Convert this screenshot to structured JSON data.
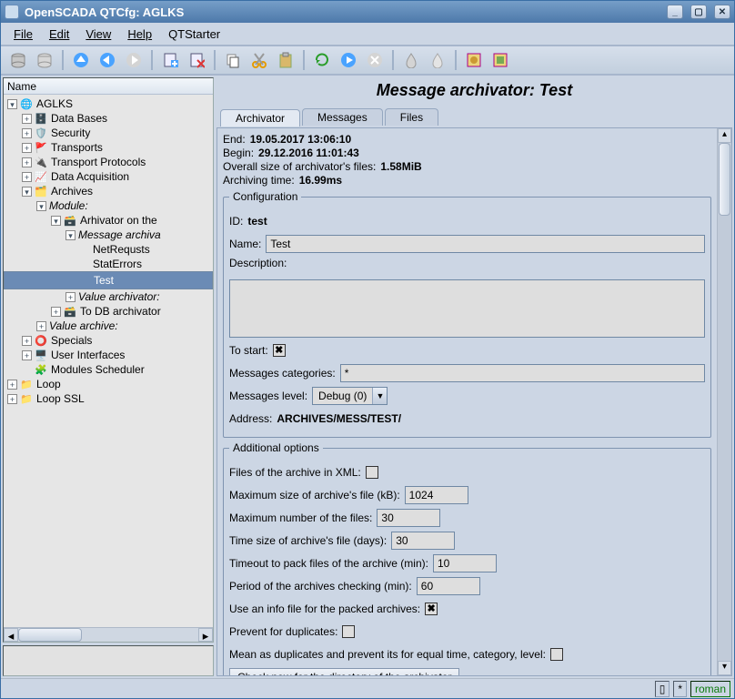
{
  "window": {
    "title": "OpenSCADA QTCfg: AGLKS",
    "buttons": {
      "min": "_",
      "max": "▢",
      "close": "✕"
    }
  },
  "menu": [
    "File",
    "Edit",
    "View",
    "Help",
    "QTStarter"
  ],
  "toolbar_icons": [
    "db-grey-icon",
    "db-grey2-icon",
    "sep",
    "arrow-up-icon",
    "arrow-back-icon",
    "arrow-fwd-icon",
    "sep",
    "add-item-icon",
    "delete-item-icon",
    "sep",
    "copy-icon",
    "cut-icon",
    "paste-icon",
    "sep",
    "refresh-icon",
    "play-icon",
    "stop-icon",
    "sep",
    "drop-icon",
    "drop2-icon",
    "sep",
    "module1-icon",
    "module2-icon"
  ],
  "tree": {
    "header": "Name",
    "nodes": [
      {
        "d": 0,
        "exp": "-",
        "icon": "🌐",
        "label": "AGLKS"
      },
      {
        "d": 1,
        "exp": "+",
        "icon": "🗄️",
        "label": "Data Bases"
      },
      {
        "d": 1,
        "exp": "+",
        "icon": "🛡️",
        "label": "Security"
      },
      {
        "d": 1,
        "exp": "+",
        "icon": "🚩",
        "label": "Transports"
      },
      {
        "d": 1,
        "exp": "+",
        "icon": "🔌",
        "label": "Transport Protocols"
      },
      {
        "d": 1,
        "exp": "+",
        "icon": "📈",
        "label": "Data Acquisition"
      },
      {
        "d": 1,
        "exp": "-",
        "icon": "🗂️",
        "label": "Archives"
      },
      {
        "d": 2,
        "exp": "-",
        "icon": "",
        "label": "Module:",
        "italic": true
      },
      {
        "d": 3,
        "exp": "-",
        "icon": "🗃️",
        "label": "Arhivator on the"
      },
      {
        "d": 4,
        "exp": "-",
        "icon": "",
        "label": "Message archiva",
        "italic": true
      },
      {
        "d": 5,
        "exp": "",
        "icon": "",
        "label": "NetRequsts"
      },
      {
        "d": 5,
        "exp": "",
        "icon": "",
        "label": "StatErrors"
      },
      {
        "d": 5,
        "exp": "",
        "icon": "",
        "label": "Test",
        "sel": true
      },
      {
        "d": 4,
        "exp": "+",
        "icon": "",
        "label": "Value archivator:",
        "italic": true
      },
      {
        "d": 3,
        "exp": "+",
        "icon": "🗃️",
        "label": "To DB archivator"
      },
      {
        "d": 2,
        "exp": "+",
        "icon": "",
        "label": "Value archive:",
        "italic": true
      },
      {
        "d": 1,
        "exp": "+",
        "icon": "⭕",
        "label": "Specials"
      },
      {
        "d": 1,
        "exp": "+",
        "icon": "🖥️",
        "label": "User Interfaces"
      },
      {
        "d": 1,
        "exp": "",
        "icon": "🧩",
        "label": "Modules Scheduler"
      },
      {
        "d": 0,
        "exp": "+",
        "icon": "📁",
        "label": "Loop"
      },
      {
        "d": 0,
        "exp": "+",
        "icon": "📁",
        "label": "Loop SSL"
      }
    ]
  },
  "page": {
    "title": "Message archivator: Test",
    "tabs": [
      "Archivator",
      "Messages",
      "Files"
    ],
    "active_tab": 0,
    "top": {
      "end_label": "End:",
      "end_value": "19.05.2017 13:06:10",
      "begin_label": "Begin:",
      "begin_value": "29.12.2016 11:01:43",
      "size_label": "Overall size of archivator's files:",
      "size_value": "1.58MiB",
      "atime_label": "Archiving time:",
      "atime_value": "16.99ms"
    },
    "cfg": {
      "legend": "Configuration",
      "id_label": "ID:",
      "id_value": "test",
      "name_label": "Name:",
      "name_value": "Test",
      "desc_label": "Description:",
      "desc_value": "",
      "tostart_label": "To start:",
      "tostart_checked": true,
      "cats_label": "Messages categories:",
      "cats_value": "*",
      "level_label": "Messages level:",
      "level_value": "Debug (0)",
      "addr_label": "Address:",
      "addr_value": "ARCHIVES/MESS/TEST/"
    },
    "adv": {
      "legend": "Additional options",
      "xml_label": "Files of the archive in XML:",
      "xml_checked": false,
      "maxsize_label": "Maximum size of archive's file (kB):",
      "maxsize_value": "1024",
      "maxnum_label": "Maximum number of the files:",
      "maxnum_value": "30",
      "timesz_label": "Time size of archive's file (days):",
      "timesz_value": "30",
      "pack_label": "Timeout to pack files of the archive (min):",
      "pack_value": "10",
      "period_label": "Period of the archives checking (min):",
      "period_value": "60",
      "info_label": "Use an info file for the packed archives:",
      "info_checked": true,
      "dup_label": "Prevent for duplicates:",
      "dup_checked": false,
      "mean_label": "Mean as duplicates and prevent its for equal time, category, level:",
      "mean_checked": false,
      "check_button": "Check now for the directory of the archivator"
    }
  },
  "status": {
    "star": "*",
    "user": "roman"
  }
}
